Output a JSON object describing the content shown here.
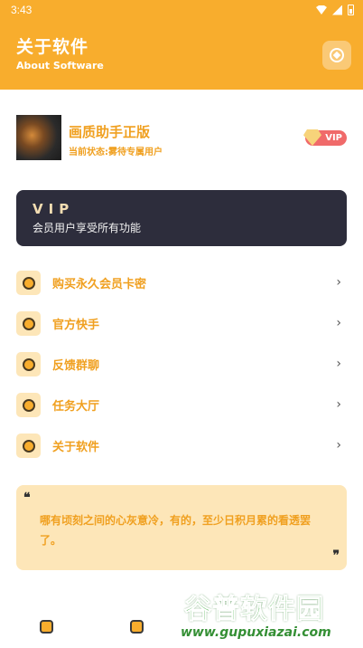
{
  "status_bar": {
    "time": "3:43"
  },
  "header": {
    "title": "关于软件",
    "subtitle": "About Software",
    "compass_icon": "compass-icon"
  },
  "profile": {
    "app_name": "画质助手正版",
    "status": "当前状态:雾待专属用户",
    "badge": "VIP"
  },
  "vip_card": {
    "title": "VIP",
    "description": "会员用户享受所有功能"
  },
  "menu": {
    "items": [
      {
        "label": "购买永久会员卡密",
        "icon": "chat-icon"
      },
      {
        "label": "官方快手",
        "icon": "check-badge-icon"
      },
      {
        "label": "反馈群聊",
        "icon": "message-icon"
      },
      {
        "label": "任务大厅",
        "icon": "task-icon"
      },
      {
        "label": "关于软件",
        "icon": "info-icon"
      }
    ],
    "chevron": "›"
  },
  "quote": {
    "open": "❝",
    "text": "哪有顷刻之间的心灰意冷，有的，至少日积月累的看透罢了。",
    "close": "❞"
  },
  "watermark": {
    "name": "谷普软件园",
    "url": "www.gupuxiazai.com"
  },
  "colors": {
    "accent": "#f8ad2d",
    "accent_text": "#f0a020",
    "card_dark": "#2d2d3c",
    "quote_bg": "#fde6b8"
  }
}
